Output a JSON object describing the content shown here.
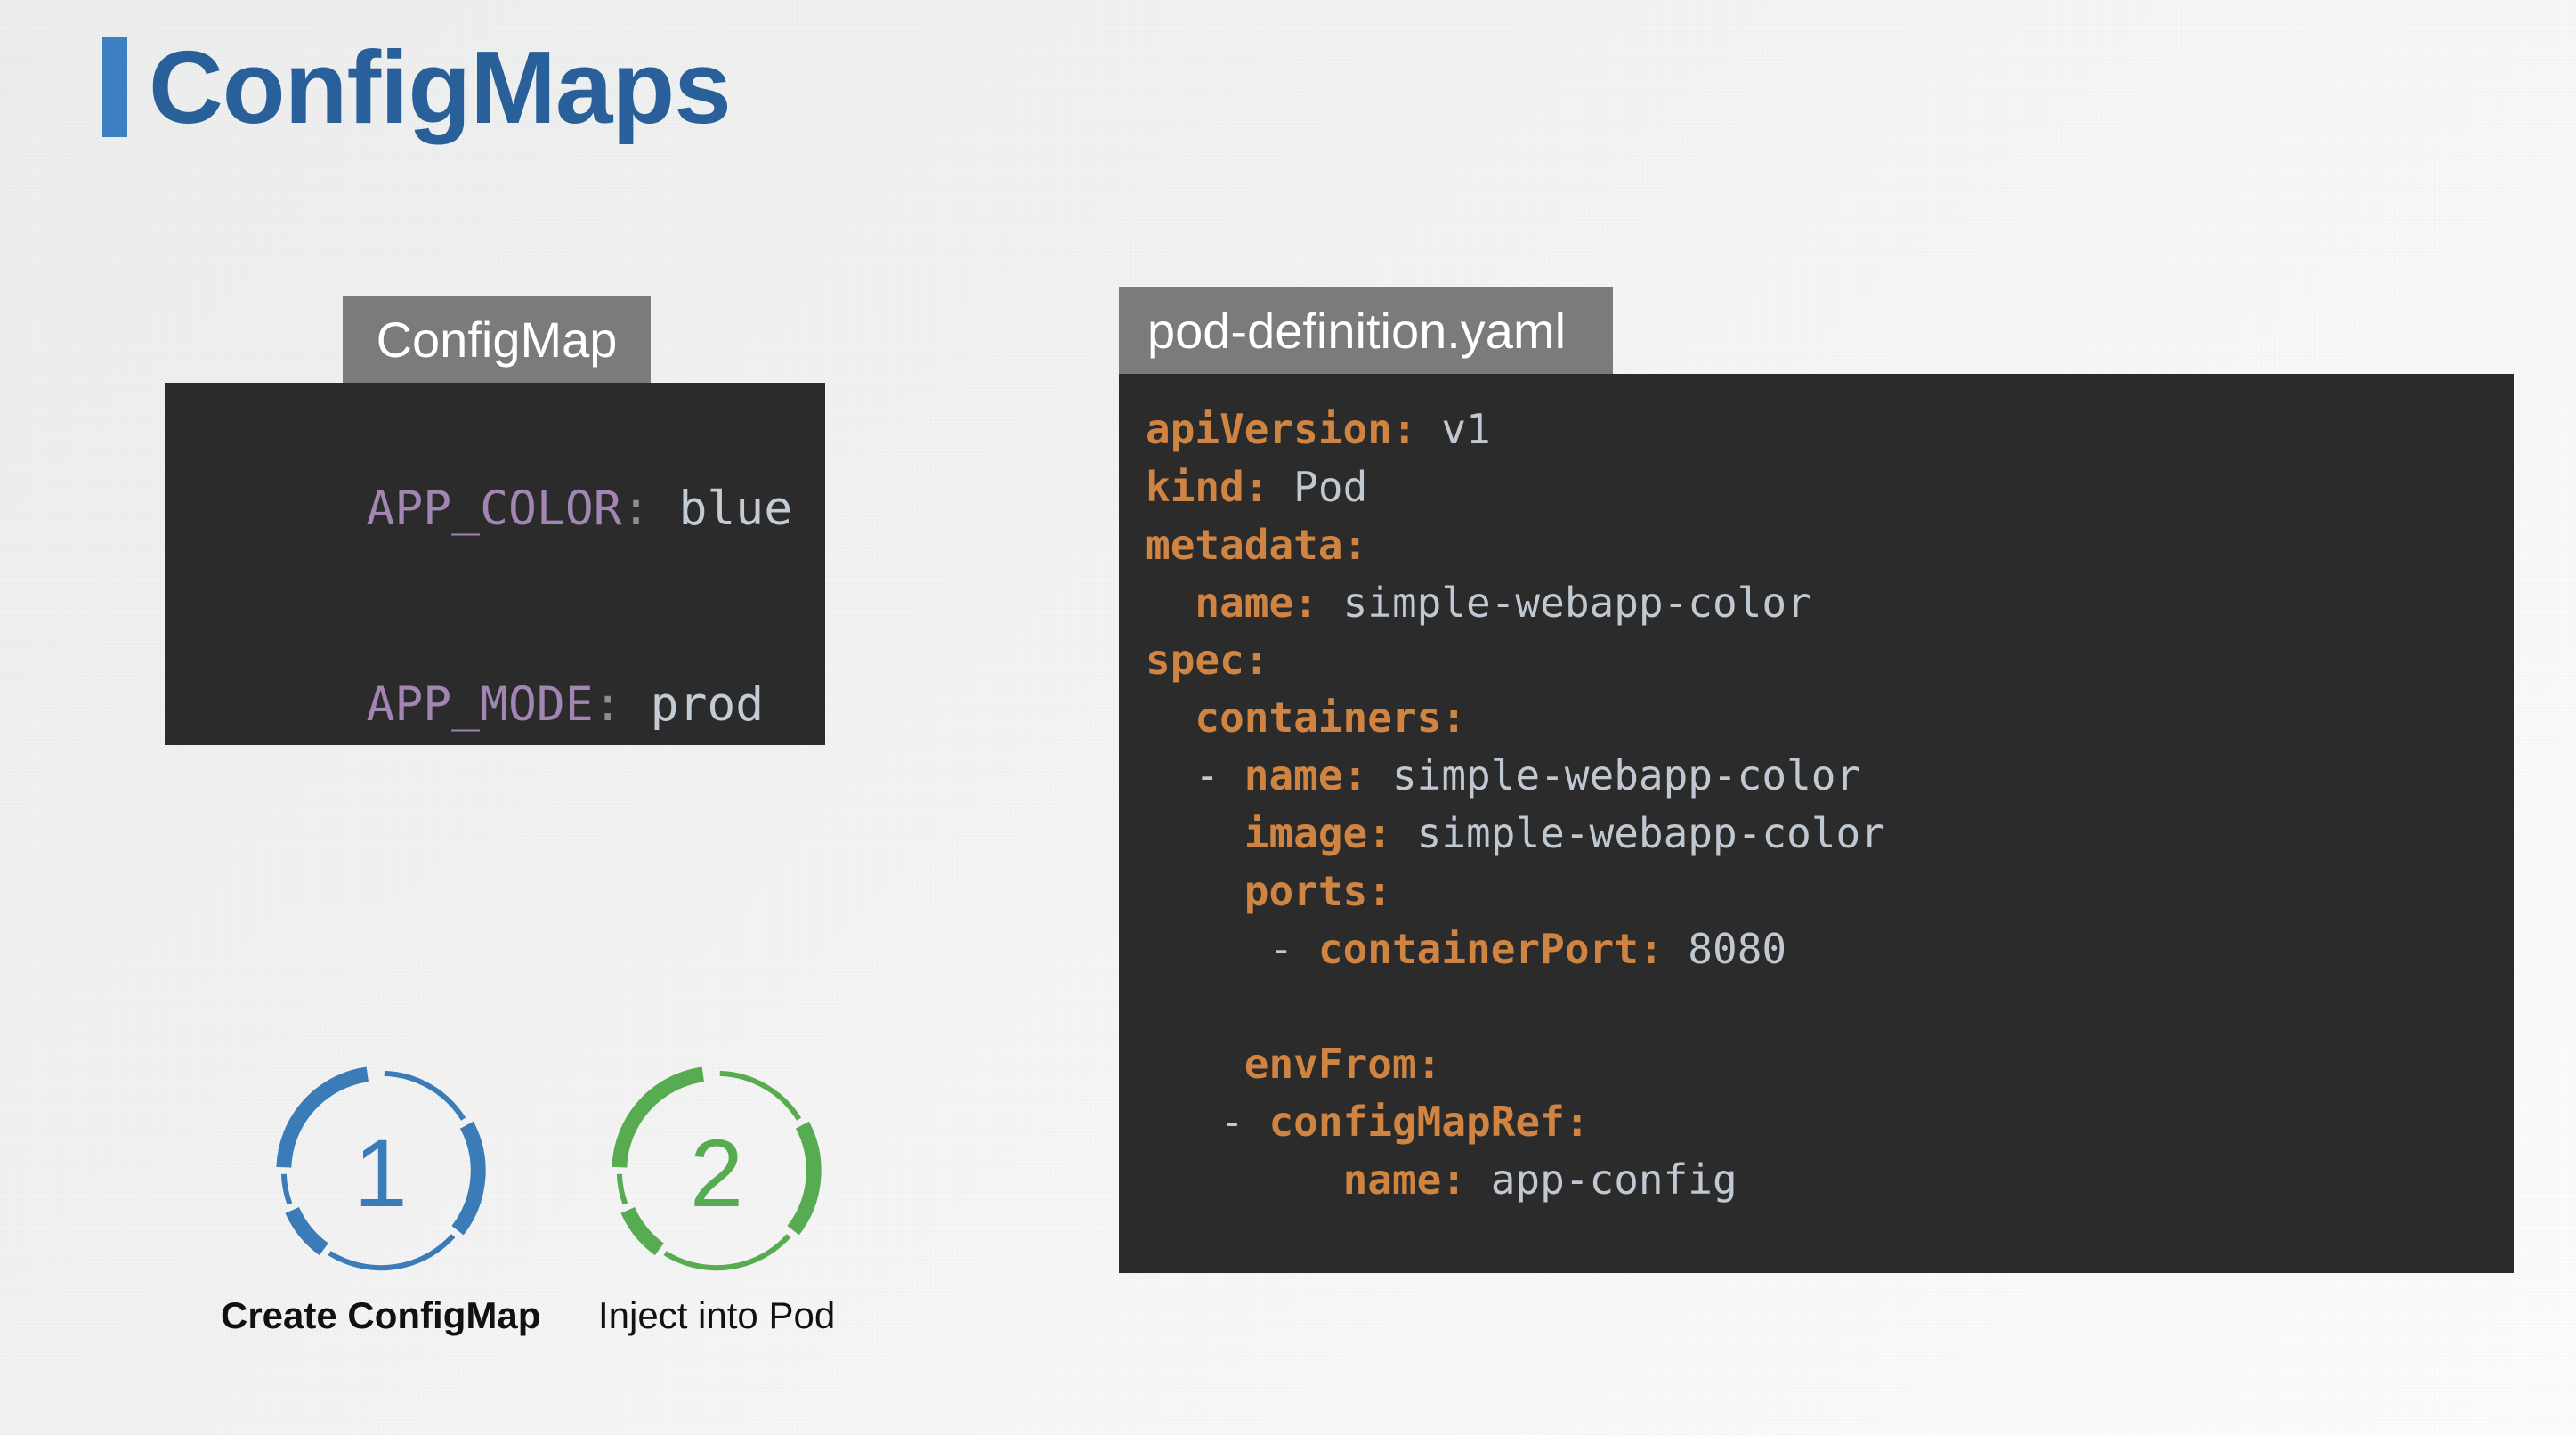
{
  "slide": {
    "title": "ConfigMaps",
    "accent_color": "#3d7fc0",
    "title_color": "#2a6099",
    "background_color": "#f2f2f2"
  },
  "configmap_panel": {
    "tab_label": "ConfigMap",
    "tab_bg": "#7b7b7b",
    "body_bg": "#2b2b2b",
    "key_color": "#a285b2",
    "value_color": "#c3cbd4",
    "entries": [
      {
        "key": "APP_COLOR",
        "colon": ":",
        "value": "blue"
      },
      {
        "key": "APP_MODE",
        "colon": ":",
        "value": "prod"
      }
    ]
  },
  "yaml_panel": {
    "tab_label": "pod-definition.yaml",
    "tab_bg": "#7b7b7b",
    "body_bg": "#2b2b2b",
    "key_color": "#d08442",
    "value_color": "#c0c8d2",
    "lines": [
      {
        "indent": "",
        "dash": "",
        "key": "apiVersion",
        "colon": ":",
        "value": "v1"
      },
      {
        "indent": "",
        "dash": "",
        "key": "kind",
        "colon": ":",
        "value": "Pod"
      },
      {
        "indent": "",
        "dash": "",
        "key": "metadata",
        "colon": ":",
        "value": ""
      },
      {
        "indent": "  ",
        "dash": "",
        "key": "name",
        "colon": ":",
        "value": "simple-webapp-color"
      },
      {
        "indent": "",
        "dash": "",
        "key": "spec",
        "colon": ":",
        "value": ""
      },
      {
        "indent": "  ",
        "dash": "",
        "key": "containers",
        "colon": ":",
        "value": ""
      },
      {
        "indent": "  ",
        "dash": "- ",
        "key": "name",
        "colon": ":",
        "value": "simple-webapp-color"
      },
      {
        "indent": "    ",
        "dash": "",
        "key": "image",
        "colon": ":",
        "value": "simple-webapp-color"
      },
      {
        "indent": "    ",
        "dash": "",
        "key": "ports",
        "colon": ":",
        "value": ""
      },
      {
        "indent": "     ",
        "dash": "- ",
        "key": "containerPort",
        "colon": ":",
        "value": "8080"
      },
      {
        "indent": "",
        "dash": "",
        "key": "",
        "colon": "",
        "value": ""
      },
      {
        "indent": "    ",
        "dash": "",
        "key": "envFrom",
        "colon": ":",
        "value": ""
      },
      {
        "indent": "   ",
        "dash": "- ",
        "key": "configMapRef",
        "colon": ":",
        "value": ""
      },
      {
        "indent": "        ",
        "dash": "",
        "key": "name",
        "colon": ":",
        "value": "app-config"
      }
    ]
  },
  "steps": [
    {
      "number": "1",
      "label": "Create ConfigMap",
      "color": "#3b7cb8"
    },
    {
      "number": "2",
      "label": "Inject into Pod",
      "color": "#57ab51"
    }
  ]
}
